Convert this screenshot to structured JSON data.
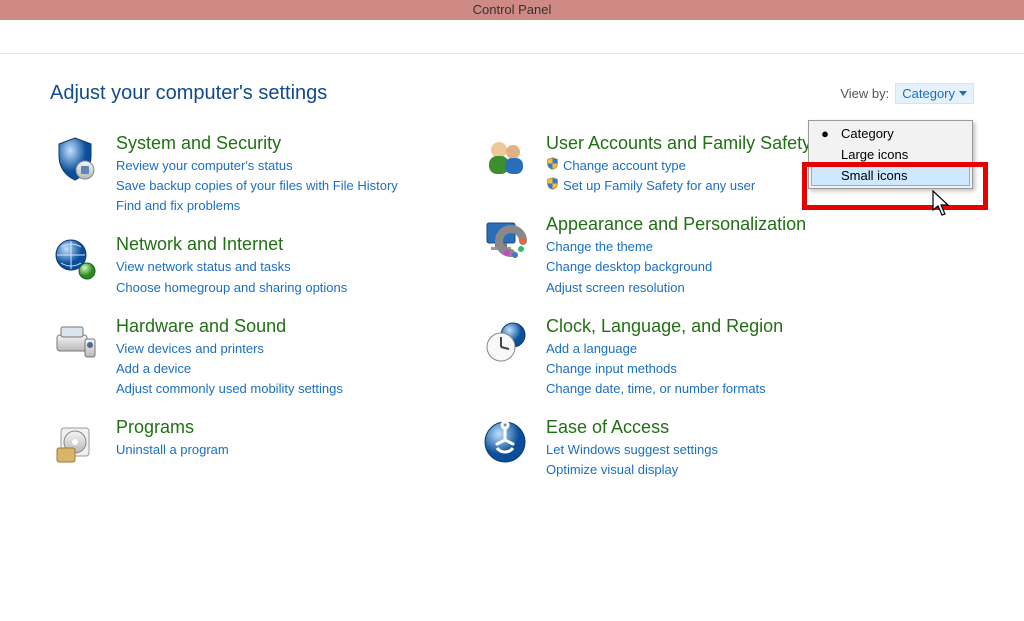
{
  "window": {
    "title": "Control Panel"
  },
  "header": {
    "page_title": "Adjust your computer's settings",
    "viewby_label": "View by:",
    "viewby_selected": "Category"
  },
  "dropdown": {
    "items": [
      {
        "label": "Category",
        "selected": true
      },
      {
        "label": "Large icons",
        "selected": false
      },
      {
        "label": "Small icons",
        "selected": false
      }
    ]
  },
  "categories": {
    "left": [
      {
        "icon": "system-security-icon",
        "title": "System and Security",
        "links": [
          {
            "text": "Review your computer's status",
            "shield": false
          },
          {
            "text": "Save backup copies of your files with File History",
            "shield": false
          },
          {
            "text": "Find and fix problems",
            "shield": false
          }
        ]
      },
      {
        "icon": "network-internet-icon",
        "title": "Network and Internet",
        "links": [
          {
            "text": "View network status and tasks",
            "shield": false
          },
          {
            "text": "Choose homegroup and sharing options",
            "shield": false
          }
        ]
      },
      {
        "icon": "hardware-sound-icon",
        "title": "Hardware and Sound",
        "links": [
          {
            "text": "View devices and printers",
            "shield": false
          },
          {
            "text": "Add a device",
            "shield": false
          },
          {
            "text": "Adjust commonly used mobility settings",
            "shield": false
          }
        ]
      },
      {
        "icon": "programs-icon",
        "title": "Programs",
        "links": [
          {
            "text": "Uninstall a program",
            "shield": false
          }
        ]
      }
    ],
    "right": [
      {
        "icon": "user-accounts-icon",
        "title": "User Accounts and Family Safety",
        "links": [
          {
            "text": "Change account type",
            "shield": true
          },
          {
            "text": "Set up Family Safety for any user",
            "shield": true
          }
        ]
      },
      {
        "icon": "appearance-icon",
        "title": "Appearance and Personalization",
        "links": [
          {
            "text": "Change the theme",
            "shield": false
          },
          {
            "text": "Change desktop background",
            "shield": false
          },
          {
            "text": "Adjust screen resolution",
            "shield": false
          }
        ]
      },
      {
        "icon": "clock-region-icon",
        "title": "Clock, Language, and Region",
        "links": [
          {
            "text": "Add a language",
            "shield": false
          },
          {
            "text": "Change input methods",
            "shield": false
          },
          {
            "text": "Change date, time, or number formats",
            "shield": false
          }
        ]
      },
      {
        "icon": "ease-of-access-icon",
        "title": "Ease of Access",
        "links": [
          {
            "text": "Let Windows suggest settings",
            "shield": false
          },
          {
            "text": "Optimize visual display",
            "shield": false
          }
        ]
      }
    ]
  }
}
